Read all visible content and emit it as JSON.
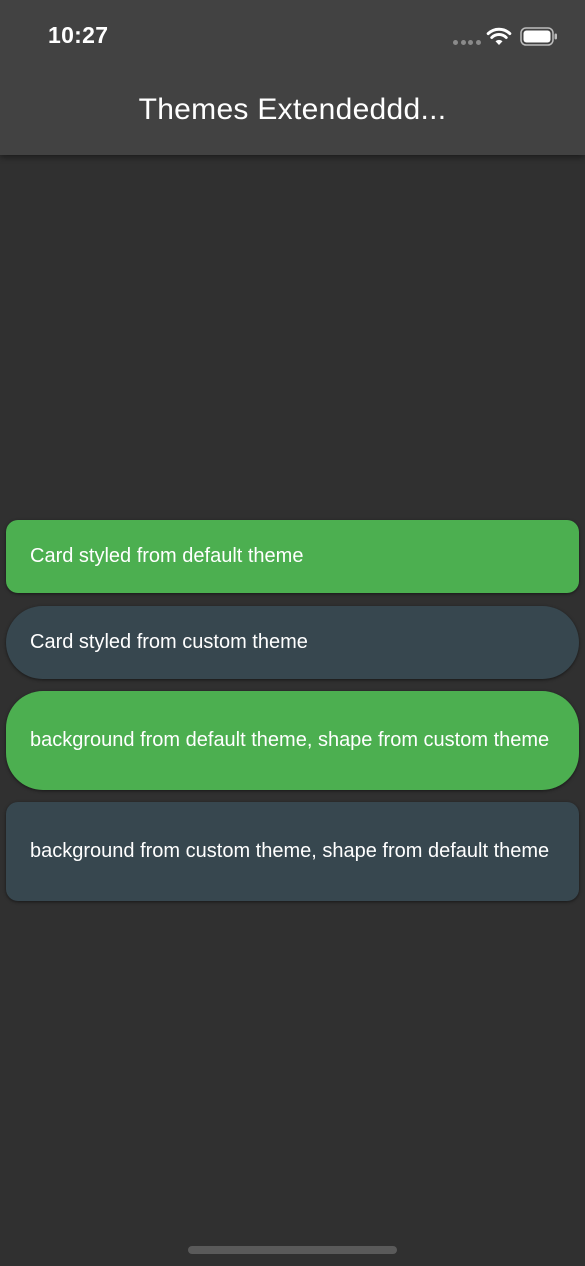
{
  "status_bar": {
    "time": "10:27",
    "icons": [
      "signal-dots-icon",
      "wifi-icon",
      "battery-icon"
    ]
  },
  "app_bar": {
    "title": "Themes Extendeddd..."
  },
  "cards": [
    {
      "text": "Card styled from default theme",
      "background": "#4caf50",
      "shape": "default"
    },
    {
      "text": "Card styled from custom theme",
      "background": "#37474f",
      "shape": "custom"
    },
    {
      "text": "background from default theme, shape from custom theme",
      "background": "#4caf50",
      "shape": "custom"
    },
    {
      "text": "background from custom theme, shape from default theme",
      "background": "#37474f",
      "shape": "default"
    }
  ],
  "colors": {
    "scaffold_background": "#303030",
    "app_bar_background": "#424242",
    "default_card": "#4caf50",
    "custom_card": "#37474f",
    "text": "#ffffff"
  }
}
